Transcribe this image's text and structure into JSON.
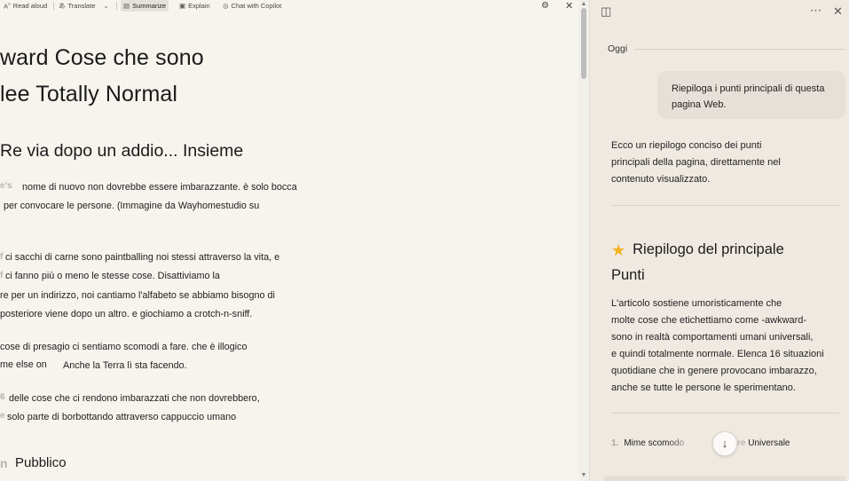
{
  "toolbar": {
    "read_aloud": "Read aloud",
    "translate": "Translate",
    "summarize": "Summarize",
    "explain": "Explain",
    "chat": "Chat with Copilot"
  },
  "article": {
    "title_line1": "ward Cose che sono",
    "title_line2": "lee Totally Normal",
    "subtitle": "Re via dopo un addio... Insieme",
    "p1_drop": "e's",
    "p1_l1": "nome di nuovo non dovrebbe essere imbarazzante. è solo bocca",
    "p1_l2": "per convocare le persone. (Immagine da Wayhomestudio su",
    "p2_drop": "f",
    "p2_l1": "ci sacchi di carne sono paintballing noi stessi attraverso la vita, e",
    "p2_drop2": "f",
    "p2_l2": "ci fanno più o meno le stesse cose. Disattiviamo la",
    "p2_l3": "re per un indirizzo, noi cantiamo l'alfabeto se abbiamo bisogno di",
    "p2_l4": "posteriore viene dopo un altro. e giochiamo a crotch-n-sniff.",
    "p3_l1": "cose di presagio ci sentiamo scomodi a fare. che è illogico",
    "p3_l2a": "me else on",
    "p3_l2b": "Anche la Terra lì sta facendo.",
    "p4_drop": "6",
    "p4_l1": "delle cose che ci rendono imbarazzati che non dovrebbero,",
    "p4_drop2": "e",
    "p4_l2": "solo parte di borbottando attraverso cappuccio umano",
    "h3_drop": "n",
    "h3": "Pubblico"
  },
  "copilot": {
    "today": "Oggi",
    "user_message": "Riepiloga i punti principali di questa pagina Web.",
    "ai_intro_l1": "Ecco un riepilogo conciso dei punti",
    "ai_intro_l2": "principali della pagina, direttamente nel",
    "ai_intro_l3": "contenuto visualizzato.",
    "section_title_l1": "Riepilogo del principale",
    "section_title_l2": "Punti",
    "summary_l1": "L'articolo sostiene umoristicamente che",
    "summary_l2": "molte cose che etichettiamo come -awkward-",
    "summary_l3": "sono in realtà comportamenti umani universali,",
    "summary_l4": "e quindi totalmente normale. Elenca 16 situazioni",
    "summary_l5": "quotidiane che in genere provocano imbarazzo,",
    "summary_l6": "anche se tutte le persone le sperimentano.",
    "list_num": "1.",
    "list_item": "Mime scomodo",
    "list_item_pre": "re",
    "list_item_right": "Universale"
  },
  "icons": {
    "read_aloud": "read-aloud-icon",
    "translate": "translate-icon",
    "summarize": "summarize-icon",
    "explain": "explain-icon",
    "chat": "chat-icon",
    "settings": "gear-icon",
    "close": "close-icon",
    "sidebar": "sidebar-icon",
    "more": "more-icon",
    "scroll_down": "arrow-down-icon",
    "star": "star-icon"
  },
  "colors": {
    "accent_star": "#f3b21c",
    "reader_bg": "#f7f4ee",
    "pane_bg": "#efe9e2"
  }
}
